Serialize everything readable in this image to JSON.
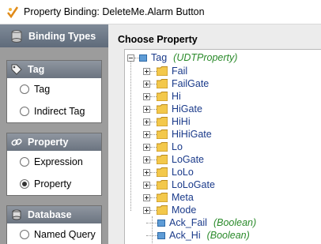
{
  "window": {
    "title": "Property Binding: DeleteMe.Alarm Button"
  },
  "sidebar": {
    "header": "Binding Types",
    "sections": [
      {
        "title": "Tag",
        "options": [
          {
            "label": "Tag",
            "selected": false
          },
          {
            "label": "Indirect Tag",
            "selected": false
          }
        ]
      },
      {
        "title": "Property",
        "options": [
          {
            "label": "Expression",
            "selected": false
          },
          {
            "label": "Property",
            "selected": true
          }
        ]
      },
      {
        "title": "Database",
        "options": [
          {
            "label": "Named Query",
            "selected": false
          }
        ]
      }
    ]
  },
  "main": {
    "heading": "Choose Property",
    "root": {
      "name": "Tag",
      "type": "(UDTProperty)"
    },
    "folders": [
      "Fail",
      "FailGate",
      "Hi",
      "HiGate",
      "HiHi",
      "HiHiGate",
      "Lo",
      "LoGate",
      "LoLo",
      "LoLoGate",
      "Meta",
      "Mode"
    ],
    "leaves": [
      {
        "name": "Ack_Fail",
        "type": "(Boolean)"
      },
      {
        "name": "Ack_Hi",
        "type": "(Boolean)"
      }
    ]
  },
  "colors": {
    "tag_name": "#1a3a8a",
    "type_label": "#2a8a2a",
    "sidebar_bg": "#9c9c9c"
  }
}
